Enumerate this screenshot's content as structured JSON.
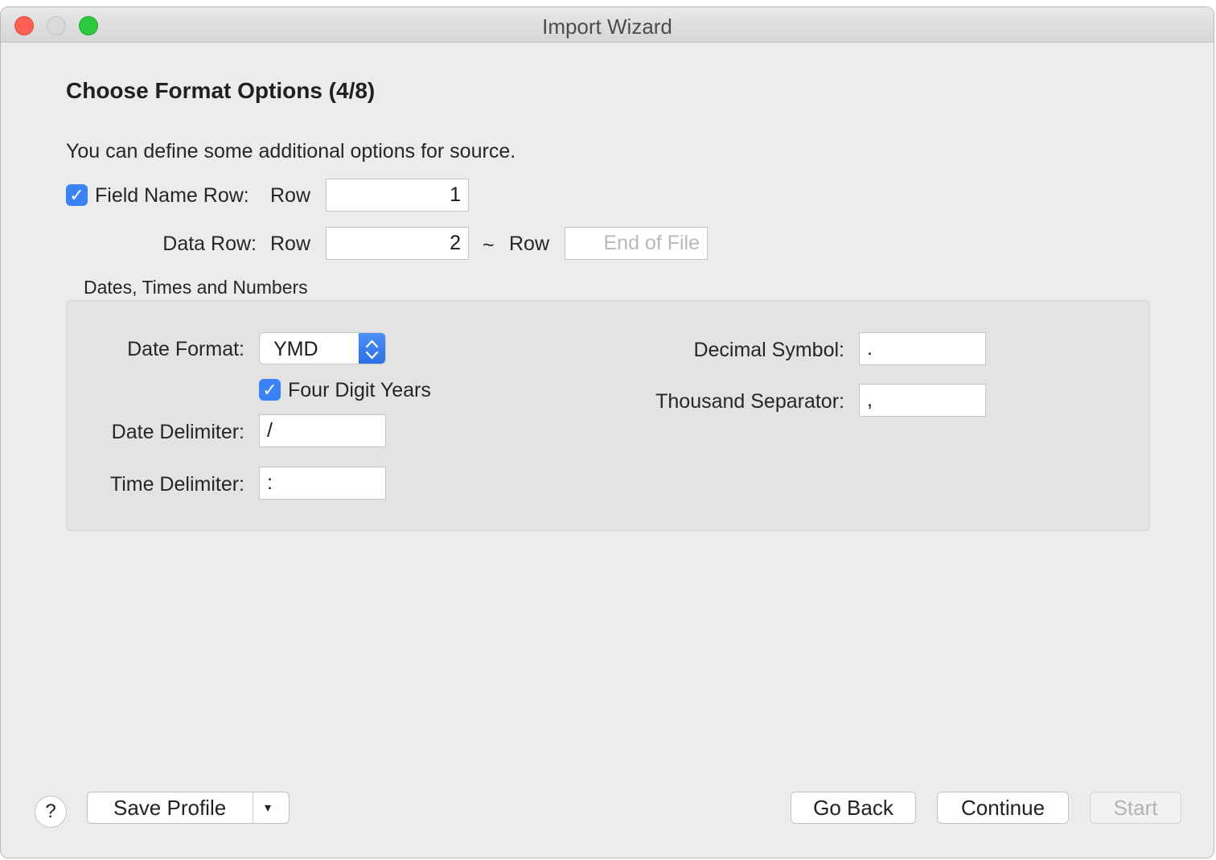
{
  "window": {
    "title": "Import Wizard"
  },
  "page": {
    "heading": "Choose Format Options (4/8)",
    "description": "You can define some additional options for source."
  },
  "field_name_row": {
    "checked": true,
    "label": "Field Name Row:",
    "row_label": "Row",
    "value": "1"
  },
  "data_row": {
    "label": "Data Row:",
    "row_label": "Row",
    "value": "2",
    "tilde": "~",
    "end_row_label": "Row",
    "end_placeholder": "End of File"
  },
  "group": {
    "title": "Dates, Times and Numbers",
    "date_format": {
      "label": "Date Format:",
      "value": "YMD"
    },
    "four_digit_years": {
      "checked": true,
      "label": "Four Digit Years"
    },
    "date_delimiter": {
      "label": "Date Delimiter:",
      "value": "/"
    },
    "time_delimiter": {
      "label": "Time Delimiter:",
      "value": ":"
    },
    "decimal_symbol": {
      "label": "Decimal Symbol:",
      "value": "."
    },
    "thousand_separator": {
      "label": "Thousand Separator:",
      "value": ","
    }
  },
  "footer": {
    "help": "?",
    "save_profile": "Save Profile",
    "dropdown_arrow": "▾",
    "go_back": "Go Back",
    "continue": "Continue",
    "start": "Start"
  },
  "colors": {
    "accent": "#3b82f6",
    "window_bg": "#ececec",
    "group_bg": "#e3e3e3"
  }
}
